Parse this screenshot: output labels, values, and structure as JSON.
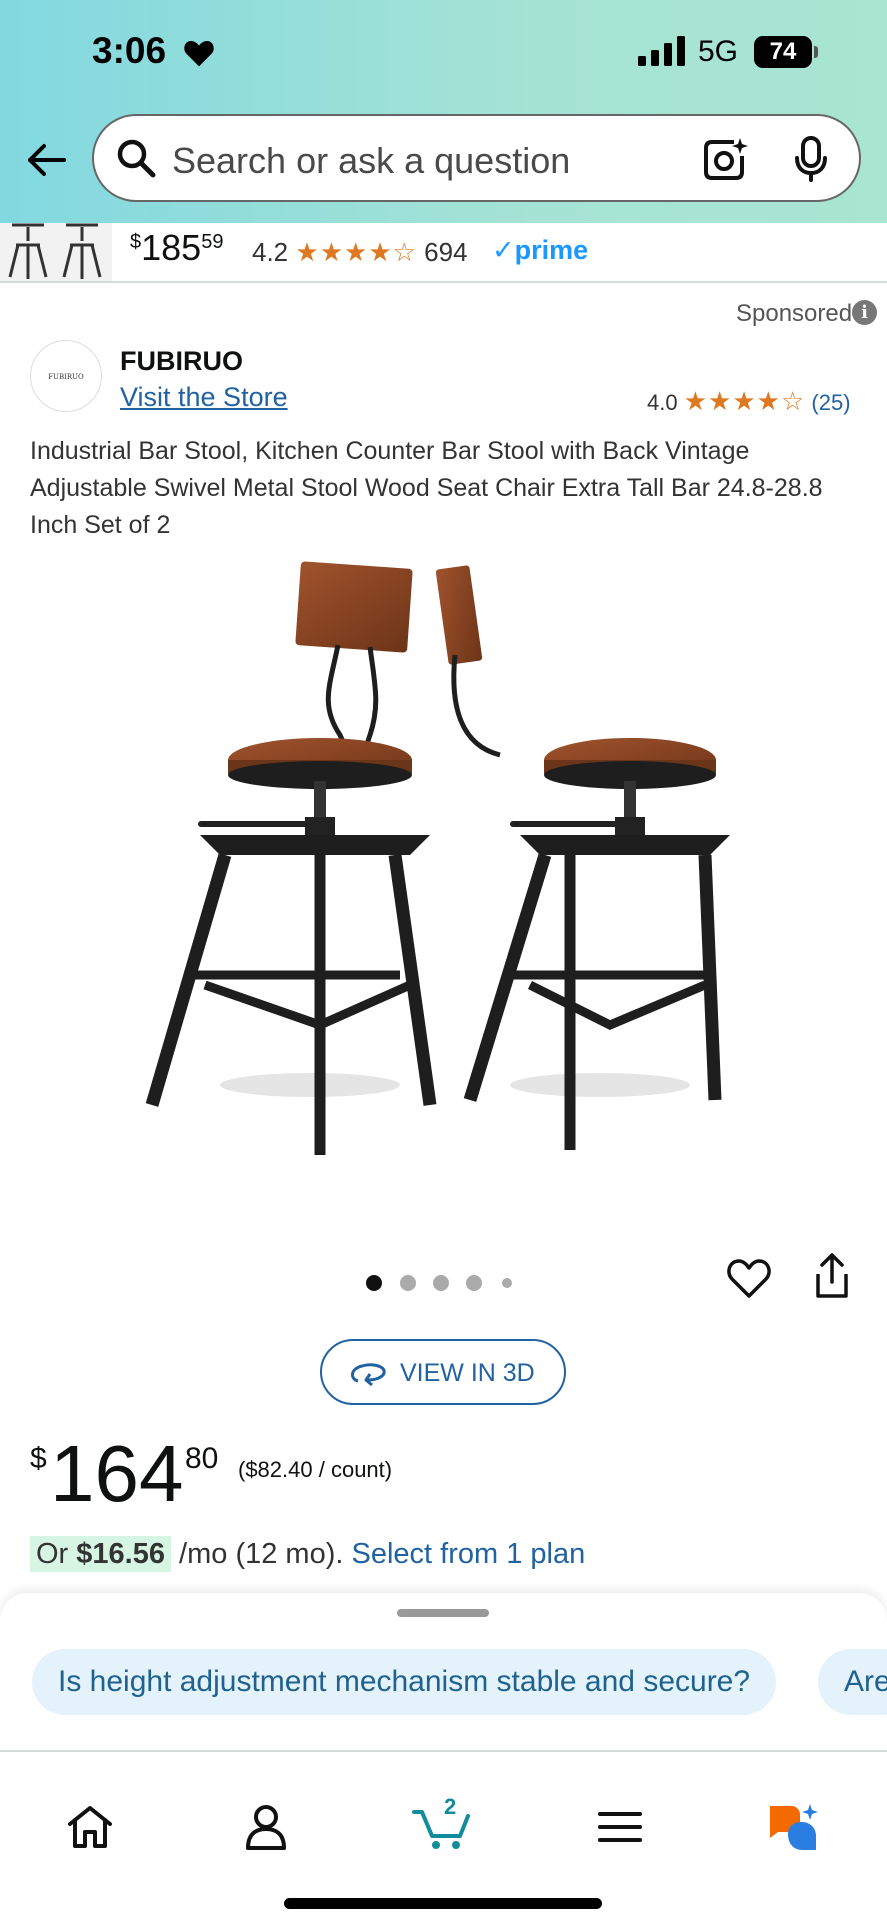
{
  "status_bar": {
    "time": "3:06",
    "network": "5G",
    "battery": "74"
  },
  "search": {
    "placeholder": "Search or ask a question"
  },
  "sticky_item": {
    "price_whole": "185",
    "price_fraction": "59",
    "rating": "4.2",
    "stars": "★★★★☆",
    "review_count": "694",
    "prime_label": "✓prime"
  },
  "sponsored_label": "Sponsored",
  "brand": {
    "logo_text": "FUBIRUO",
    "name": "FUBIRUO",
    "store_link": "Visit the Store",
    "rating": "4.0",
    "stars": "★★★★☆",
    "review_count": "(25)"
  },
  "product": {
    "title": "Industrial Bar Stool, Kitchen Counter Bar Stool with Back Vintage Adjustable Swivel Metal Stool Wood Seat Chair Extra Tall Bar 24.8-28.8 Inch Set of 2",
    "view_3d_label": "VIEW IN 3D",
    "price_symbol": "$",
    "price_whole": "164",
    "price_fraction": "80",
    "unit_price": "($82.40 / count)",
    "monthly_prefix": "Or",
    "monthly_amount": "$16.56",
    "monthly_terms": "/mo (12 mo).",
    "monthly_link": "Select from 1 plan"
  },
  "image_carousel": {
    "total_dots": 5,
    "active_index": 0
  },
  "suggestions": [
    "Is height adjustment mechanism stable and secure?",
    "Are"
  ],
  "tab_bar": {
    "cart_count": "2",
    "items": [
      "home-icon",
      "account-icon",
      "cart-icon",
      "menu-icon",
      "rufus-icon"
    ]
  },
  "colors": {
    "accent_blue": "#2162a1",
    "star_orange": "#de7921",
    "prime_blue": "#1a98ff",
    "header_gradient_start": "#82d8e0",
    "header_gradient_end": "#a9e5d0",
    "chip_bg": "#e3f2fb"
  }
}
